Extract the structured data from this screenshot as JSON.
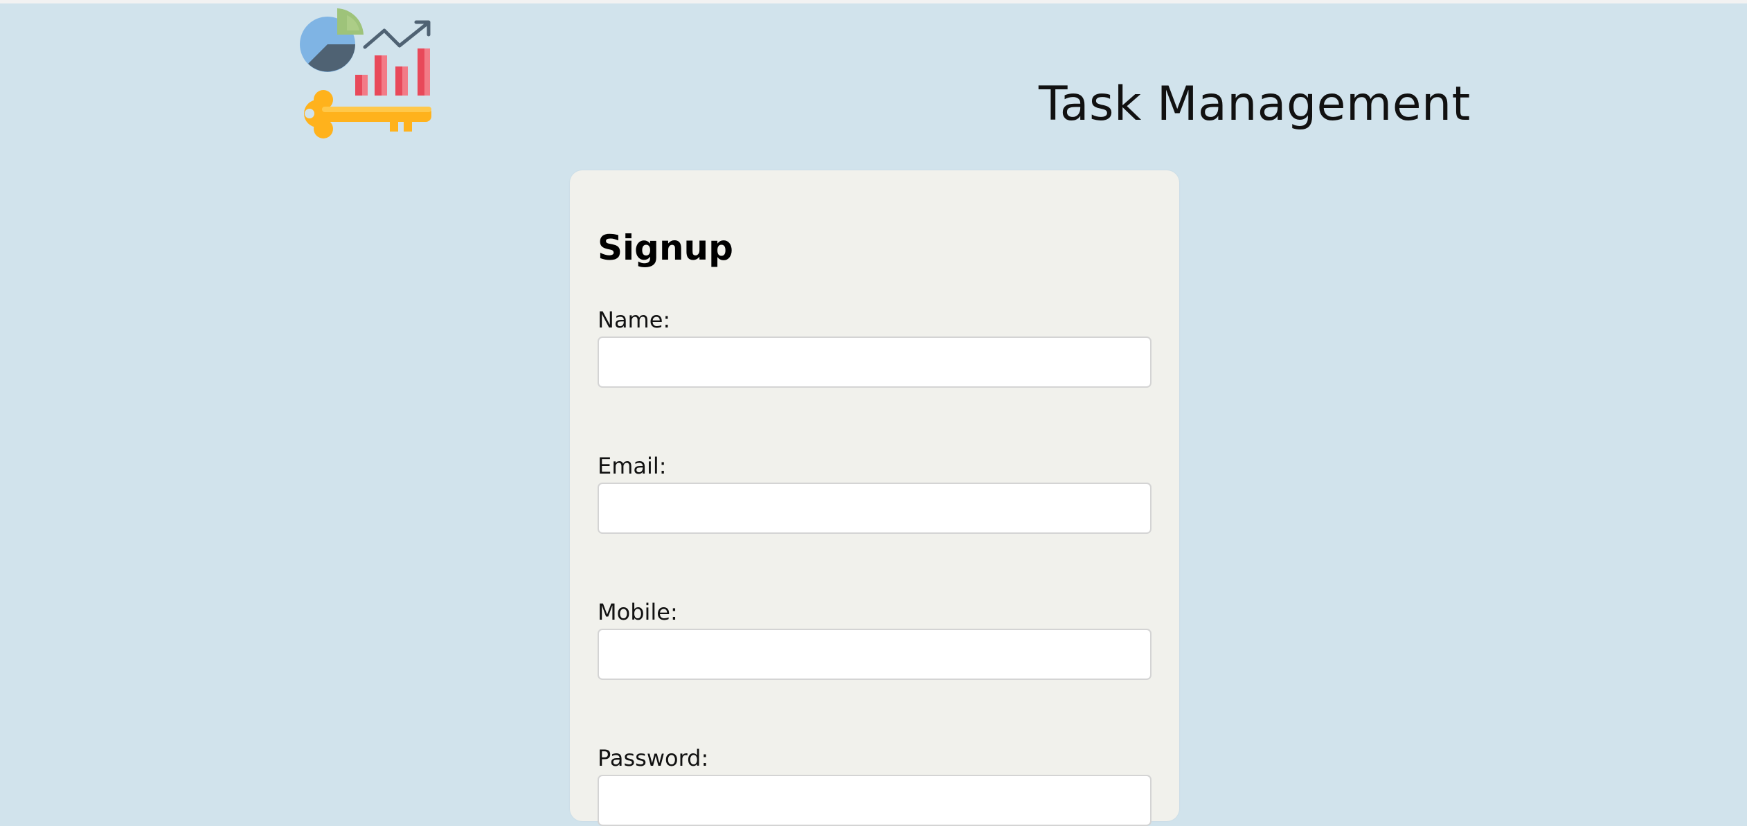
{
  "header": {
    "logo_icon": "analytics-key-logo-icon",
    "title": "Task Management"
  },
  "signup": {
    "title": "Signup",
    "fields": [
      {
        "label": "Name:",
        "value": ""
      },
      {
        "label": "Email:",
        "value": ""
      },
      {
        "label": "Mobile:",
        "value": ""
      },
      {
        "label": "Password:",
        "value": ""
      }
    ]
  },
  "colors": {
    "page_background": "#d1e3ec",
    "card_background": "#f1f1ec",
    "pie_blue": "#7fb4e4",
    "pie_dark": "#4f6273",
    "pie_green": "#9ec37a",
    "bar_red": "#e8495a",
    "key_yellow": "#ffb21c"
  }
}
